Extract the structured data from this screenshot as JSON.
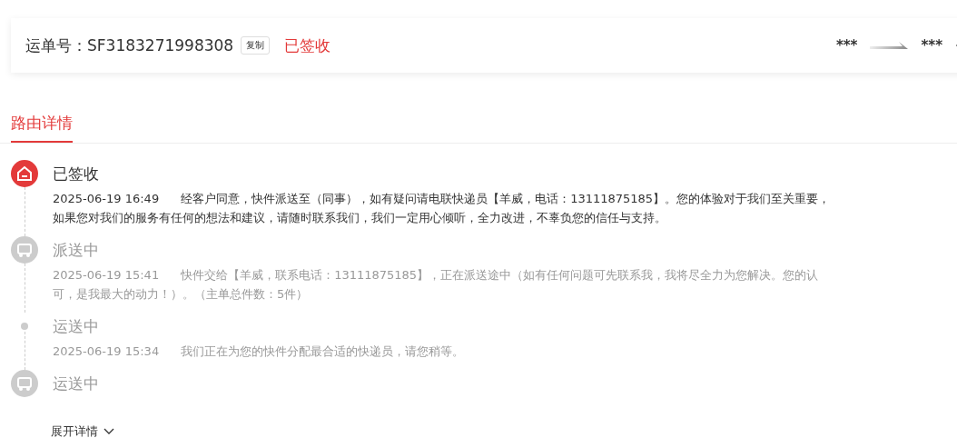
{
  "waybill": {
    "label": "运单号：",
    "number": "SF3183271998308",
    "copy_button": "复制",
    "status": "已签收",
    "from": "***",
    "to": "***"
  },
  "tabs": [
    {
      "label": "路由详情",
      "selected": true
    }
  ],
  "timeline": [
    {
      "kind": "home",
      "active": true,
      "title": "已签收",
      "time": "2025-06-19 16:49",
      "text": "经客户同意，快件派送至（同事），如有疑问请电联快递员【羊威，电话：13111875185】。您的体验对于我们至关重要，如果您对我们的服务有任何的想法和建议，请随时联系我们，我们一定用心倾听，全力改进，不辜负您的信任与支持。"
    },
    {
      "kind": "truck",
      "active": false,
      "title": "派送中",
      "time": "2025-06-19 15:41",
      "text": "快件交给【羊威，联系电话：13111875185】，正在派送途中（如有任何问题可先联系我，我将尽全力为您解决。您的认可，是我最大的动力！）。（主单总件数：5件）"
    },
    {
      "kind": "dot",
      "active": false,
      "title": "运送中",
      "time": "2025-06-19 15:34",
      "text": "我们正在为您的快件分配最合适的快递员，请您稍等。"
    },
    {
      "kind": "truck",
      "active": false,
      "title": "运送中"
    }
  ],
  "expand_button": "展开详情"
}
